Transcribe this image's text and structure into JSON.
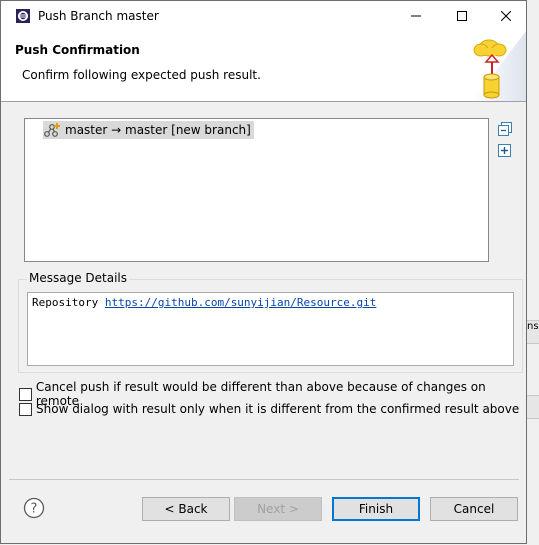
{
  "window": {
    "title": "Push Branch master"
  },
  "header": {
    "title": "Push Confirmation",
    "description": "Confirm following expected push result."
  },
  "tree": {
    "items": [
      {
        "label": "master → master [new branch]",
        "icon": "push-ref-icon"
      }
    ]
  },
  "side_buttons": {
    "collapse": "collapse-all-icon",
    "expand": "expand-all-icon"
  },
  "message_group": {
    "label": "Message Details",
    "repository_label": "Repository",
    "repository_url": "https://github.com/sunyijian/Resource.git"
  },
  "checkboxes": [
    {
      "label": "Cancel push if result would be different than above because of changes on remote",
      "checked": false
    },
    {
      "label": "Show dialog with result only when it is different from the confirmed result above",
      "checked": false
    }
  ],
  "buttons": {
    "back": "< Back",
    "next": "Next >",
    "finish": "Finish",
    "cancel": "Cancel"
  },
  "background_fragment": {
    "text": "ns"
  },
  "colors": {
    "accent": "#0078d7",
    "link": "#0645ad"
  }
}
